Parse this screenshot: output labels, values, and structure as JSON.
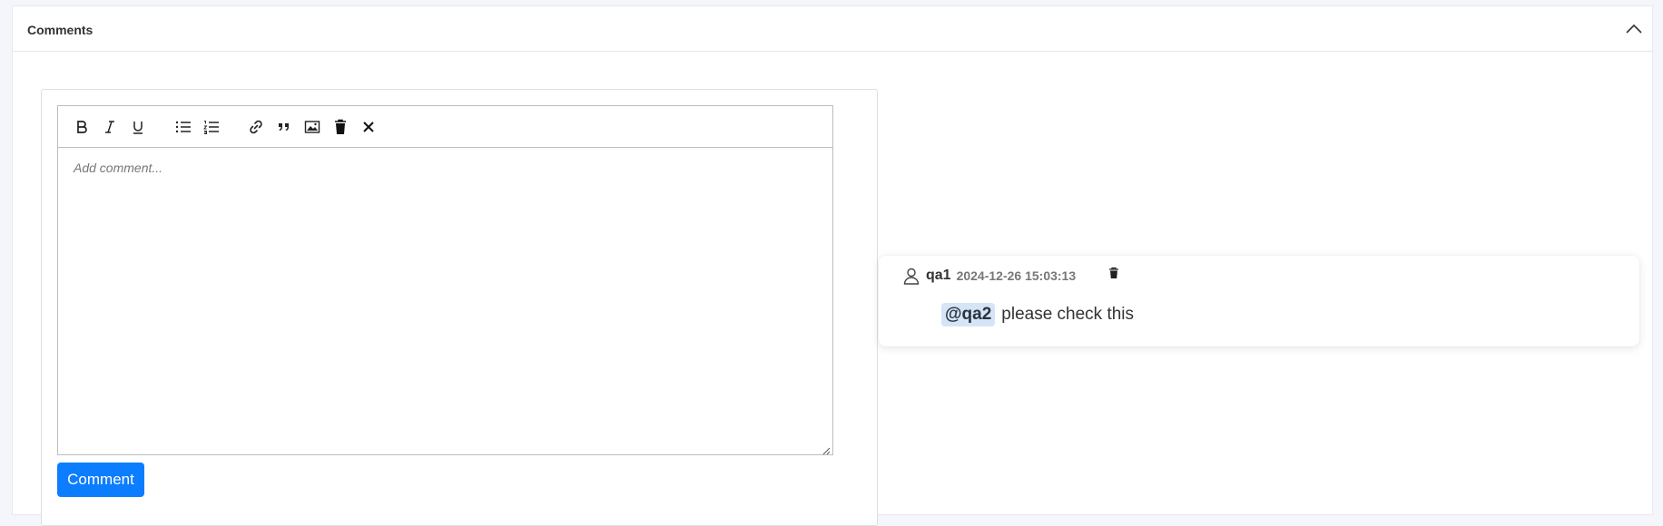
{
  "panel": {
    "title": "Comments",
    "collapse_icon": "chevron-up-icon"
  },
  "editor": {
    "toolbar": [
      {
        "name": "bold",
        "icon": "bold-icon"
      },
      {
        "name": "italic",
        "icon": "italic-icon"
      },
      {
        "name": "underline",
        "icon": "underline-icon"
      },
      {
        "name": "bullet-list",
        "icon": "bullet-list-icon"
      },
      {
        "name": "numbered-list",
        "icon": "numbered-list-icon"
      },
      {
        "name": "link",
        "icon": "link-icon"
      },
      {
        "name": "quote",
        "icon": "quote-icon"
      },
      {
        "name": "image",
        "icon": "image-icon"
      },
      {
        "name": "clear",
        "icon": "trash-icon"
      },
      {
        "name": "remove-format",
        "icon": "close-icon"
      }
    ],
    "placeholder": "Add comment...",
    "submit_label": "Comment",
    "accent_color": "#0d7dff"
  },
  "comments": [
    {
      "author": "qa1",
      "timestamp": "2024-12-26 15:03:13",
      "mention": "@qa2",
      "text": "please check this"
    }
  ]
}
